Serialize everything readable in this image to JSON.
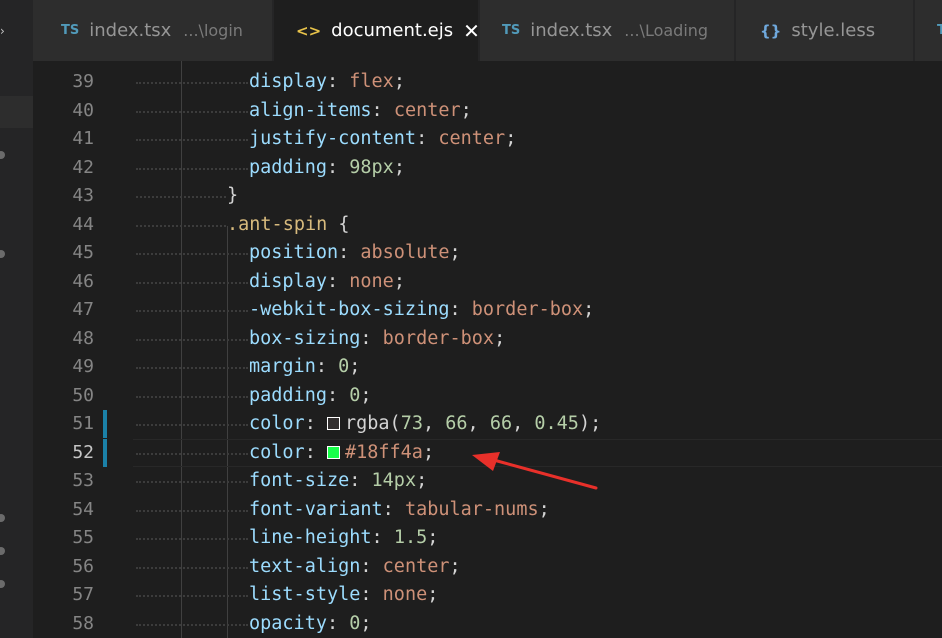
{
  "tabs": [
    {
      "icon": "TS",
      "name": "index.tsx",
      "description": "...\\login"
    },
    {
      "icon": "<>",
      "name": "document.ejs",
      "close": "✕"
    },
    {
      "icon": "TS",
      "name": "index.tsx",
      "description": "...\\Loading"
    },
    {
      "icon": "{}",
      "name": "style.less"
    },
    {
      "icon": "TS",
      "name": ""
    }
  ],
  "code": {
    "line_numbers": [
      "39",
      "40",
      "41",
      "42",
      "43",
      "44",
      "45",
      "46",
      "47",
      "48",
      "49",
      "50",
      "51",
      "52",
      "53",
      "54",
      "55",
      "56",
      "57",
      "58"
    ],
    "lines": [
      {
        "prop": "display",
        "colon": ": ",
        "value": "flex",
        "end": ";"
      },
      {
        "prop": "align-items",
        "colon": ": ",
        "value": "center",
        "end": ";"
      },
      {
        "prop": "justify-content",
        "colon": ": ",
        "value": "center",
        "end": ";"
      },
      {
        "prop": "padding",
        "colon": ": ",
        "num": "98px",
        "end": ";"
      },
      {
        "brace": "}"
      },
      {
        "selector": ".ant-spin",
        "open": " {"
      },
      {
        "prop": "position",
        "colon": ": ",
        "value": "absolute",
        "end": ";"
      },
      {
        "prop": "display",
        "colon": ": ",
        "value": "none",
        "end": ";"
      },
      {
        "prop": "-webkit-box-sizing",
        "colon": ": ",
        "value": "border-box",
        "end": ";"
      },
      {
        "prop": "box-sizing",
        "colon": ": ",
        "value": "border-box",
        "end": ";"
      },
      {
        "prop": "margin",
        "colon": ": ",
        "num": "0",
        "end": ";"
      },
      {
        "prop": "padding",
        "colon": ": ",
        "num": "0",
        "end": ";"
      },
      {
        "prop": "color",
        "colon": ": ",
        "fn": "rgba(",
        "args": [
          "73",
          "66",
          "66",
          "0.45"
        ],
        "fn_close": ")",
        "end": ";",
        "swatch": "rgba(73,66,66,0.45)"
      },
      {
        "prop": "color",
        "colon": ": ",
        "value": "#18ff4a",
        "end": ";",
        "swatch": "#18ff4a"
      },
      {
        "prop": "font-size",
        "colon": ": ",
        "num": "14px",
        "end": ";"
      },
      {
        "prop": "font-variant",
        "colon": ": ",
        "value": "tabular-nums",
        "end": ";"
      },
      {
        "prop": "line-height",
        "colon": ": ",
        "num": "1.5",
        "end": ";"
      },
      {
        "prop": "text-align",
        "colon": ": ",
        "value": "center",
        "end": ";"
      },
      {
        "prop": "list-style",
        "colon": ": ",
        "value": "none",
        "end": ";"
      },
      {
        "prop": "opacity",
        "colon": ": ",
        "num": "0",
        "end": ";"
      }
    ]
  },
  "colors": {
    "editor_bg": "#1e1e1e",
    "tab_bg": "#2d2d2d",
    "property": "#9cdcfe",
    "value": "#ce9178",
    "number": "#b5cea8",
    "selector": "#d7ba7d",
    "arrow": "#e8302a",
    "modified_gutter": "#1b81a8"
  }
}
